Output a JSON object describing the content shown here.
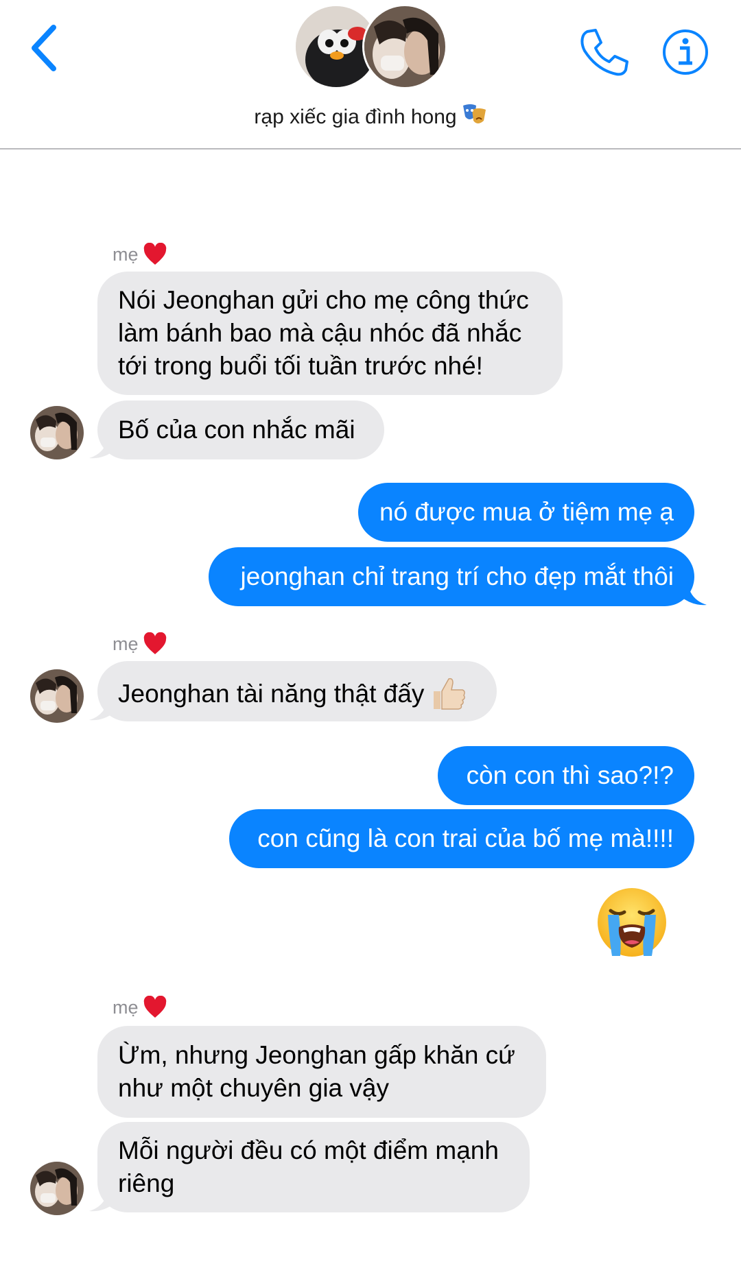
{
  "header": {
    "title": "rạp xiếc gia đình hong",
    "back_icon": "chevron-left-icon",
    "call_icon": "phone-icon",
    "info_icon": "info-icon",
    "accent": "#0a84ff"
  },
  "messages": [
    {
      "id": "m1",
      "sender": "mẹ",
      "direction": "incoming",
      "text_lines": [
        "Nói Jeonghan gửi cho mẹ công thức",
        "làm bánh bao mà cậu nhóc đã nhắc",
        "tới trong buổi tối tuần trước nhé!"
      ]
    },
    {
      "id": "m2",
      "direction": "incoming",
      "text": "Bố của con nhắc mãi"
    },
    {
      "id": "m3",
      "direction": "outgoing",
      "text": "nó được mua ở tiệm mẹ ạ"
    },
    {
      "id": "m4",
      "direction": "outgoing",
      "text": "jeonghan chỉ trang trí cho đẹp mắt thôi"
    },
    {
      "id": "m5",
      "sender": "mẹ",
      "direction": "incoming",
      "text": "Jeonghan tài năng thật đấy",
      "emoji": "thumbs-up"
    },
    {
      "id": "m6",
      "direction": "outgoing",
      "text": "còn con thì sao?!?"
    },
    {
      "id": "m7",
      "direction": "outgoing",
      "text": "con cũng là con trai của bố mẹ mà!!!!"
    },
    {
      "id": "m8",
      "direction": "outgoing",
      "emoji": "loudly-crying-face"
    },
    {
      "id": "m9",
      "sender": "mẹ",
      "direction": "incoming",
      "text_lines": [
        "Ừm, nhưng Jeonghan gấp khăn cứ",
        "như một chuyên gia vậy"
      ]
    },
    {
      "id": "m10",
      "direction": "incoming",
      "text_lines": [
        "Mỗi người đều có một điểm mạnh",
        "riêng"
      ]
    }
  ],
  "colors": {
    "incoming_bubble": "#e9e9eb",
    "outgoing_bubble": "#0a84ff",
    "sender_label": "#8e8e93"
  }
}
